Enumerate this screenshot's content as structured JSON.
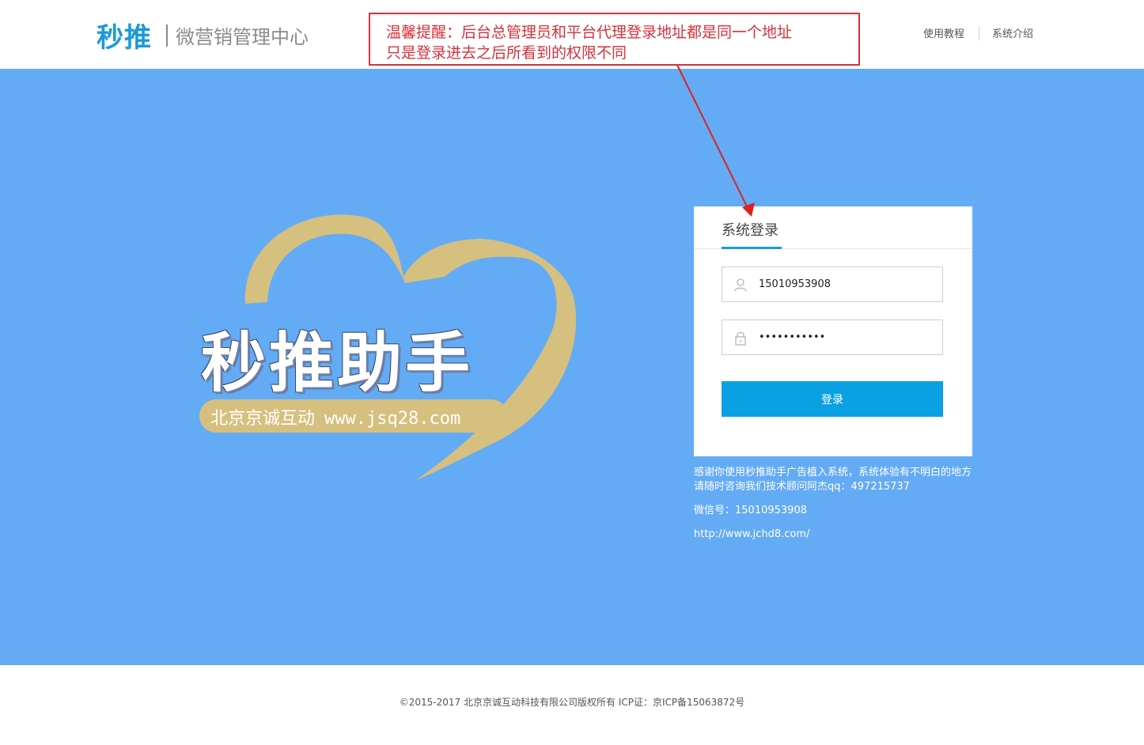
{
  "header": {
    "logo": "秒推",
    "subtitle": "微营销管理中心",
    "nav": [
      "使用教程",
      "系统介绍"
    ]
  },
  "notice": {
    "line1": "温馨提醒：后台总管理员和平台代理登录地址都是同一个地址",
    "line2": "只是登录进去之后所看到的权限不同"
  },
  "promo": {
    "title": "秒推助手",
    "company": "北京京诚互动",
    "url": "www.jsq28.com"
  },
  "login": {
    "title": "系统登录",
    "username": "15010953908",
    "password": "•••••••••••",
    "button": "登录"
  },
  "info": {
    "message": "感谢你使用秒推助手广告植入系统，系统体验有不明白的地方请随时咨询我们技术顾问阿杰qq：497215737",
    "wechat": "微信号：15010953908",
    "link": "http://www.jchd8.com/"
  },
  "footer": {
    "copyright": "©2015-2017 北京京诚互动科技有限公司版权所有 ICP证：京ICP备15063872号"
  },
  "colors": {
    "brand": "#1a9ad9",
    "hero_bg": "#64abf5",
    "button": "#0aa0e2",
    "notice": "#d9303a",
    "heart": "#d6c07f"
  },
  "icons": [
    "user-icon",
    "lock-icon"
  ]
}
